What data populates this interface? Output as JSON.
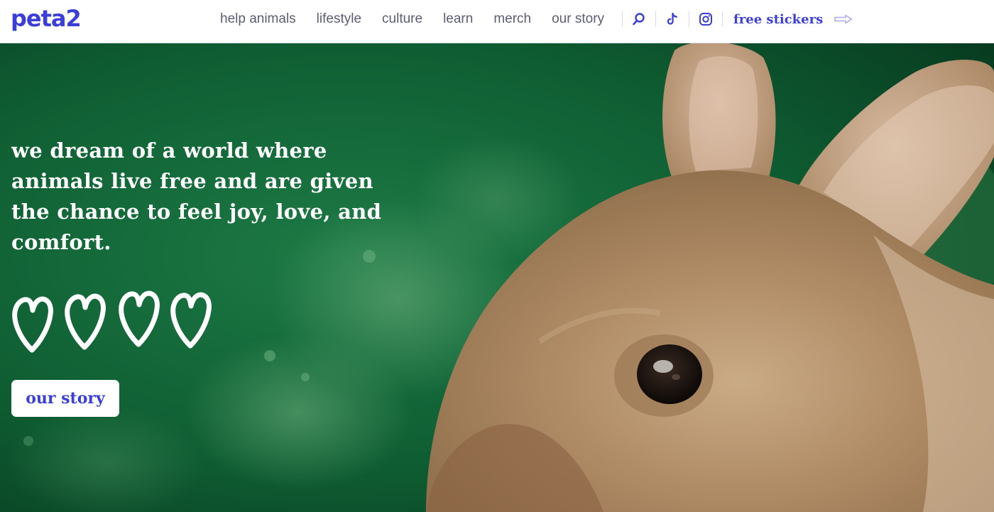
{
  "logo": {
    "text": "peta2"
  },
  "nav": {
    "links": [
      "help animals",
      "lifestyle",
      "culture",
      "learn",
      "merch",
      "our story"
    ],
    "search_icon": "search-icon",
    "tiktok_icon": "tiktok-icon",
    "instagram_icon": "instagram-icon",
    "cta_label": "free stickers",
    "cta_arrow_icon": "arrow-right-icon"
  },
  "hero": {
    "tagline": "we dream of a world where animals live free and are given the chance to feel joy, love, and comfort.",
    "hearts_count": 4,
    "button_label": "our story",
    "image": "rabbit-photo"
  },
  "colors": {
    "brand": "#3b3fd8",
    "nav_text": "#5a5d73",
    "hero_green": "#0d5a30",
    "white": "#ffffff"
  }
}
